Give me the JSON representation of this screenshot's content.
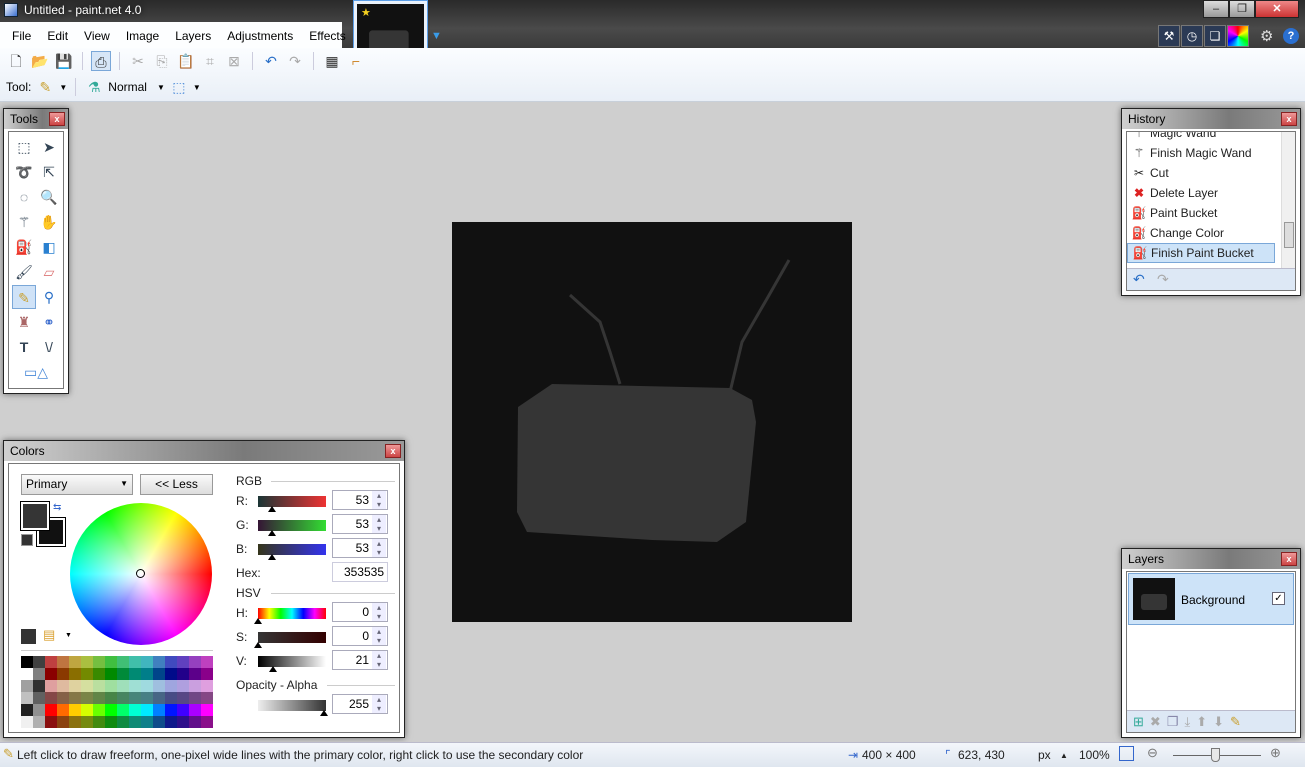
{
  "window": {
    "title": "Untitled - paint.net 4.0"
  },
  "menu": [
    "File",
    "Edit",
    "View",
    "Image",
    "Layers",
    "Adjustments",
    "Effects"
  ],
  "toolbar": {
    "tool_label": "Tool:",
    "blend_mode": "Normal"
  },
  "tools_panel": {
    "title": "Tools"
  },
  "history": {
    "title": "History",
    "items": [
      {
        "label": "Magic Wand",
        "icon": "magic-wand-icon"
      },
      {
        "label": "Finish Magic Wand",
        "icon": "magic-wand-icon"
      },
      {
        "label": "Cut",
        "icon": "scissors-icon"
      },
      {
        "label": "Delete Layer",
        "icon": "red-x-icon"
      },
      {
        "label": "Paint Bucket",
        "icon": "paint-bucket-icon"
      },
      {
        "label": "Change Color",
        "icon": "paint-bucket-icon"
      },
      {
        "label": "Finish Paint Bucket",
        "icon": "paint-bucket-icon",
        "selected": true
      }
    ]
  },
  "colors": {
    "title": "Colors",
    "mode": "Primary",
    "less_button": "<< Less",
    "rgb_label": "RGB",
    "r_label": "R:",
    "g_label": "G:",
    "b_label": "B:",
    "r": "53",
    "g": "53",
    "b": "53",
    "hex_label": "Hex:",
    "hex": "353535",
    "hsv_label": "HSV",
    "h_label": "H:",
    "s_label": "S:",
    "v_label": "V:",
    "h": "0",
    "s": "0",
    "v": "21",
    "opacity_label": "Opacity - Alpha",
    "alpha": "255",
    "primary_color": "#353535",
    "secondary_color": "#111111"
  },
  "layers": {
    "title": "Layers",
    "items": [
      {
        "name": "Background",
        "visible": true
      }
    ]
  },
  "canvas": {
    "background": "#111111",
    "shape_color": "#353535"
  },
  "status": {
    "hint": "Left click to draw freeform, one-pixel wide lines with the primary color, right click to use the secondary color",
    "size": "400 × 400",
    "cursor": "623, 430",
    "unit": "px",
    "zoom": "100%"
  }
}
